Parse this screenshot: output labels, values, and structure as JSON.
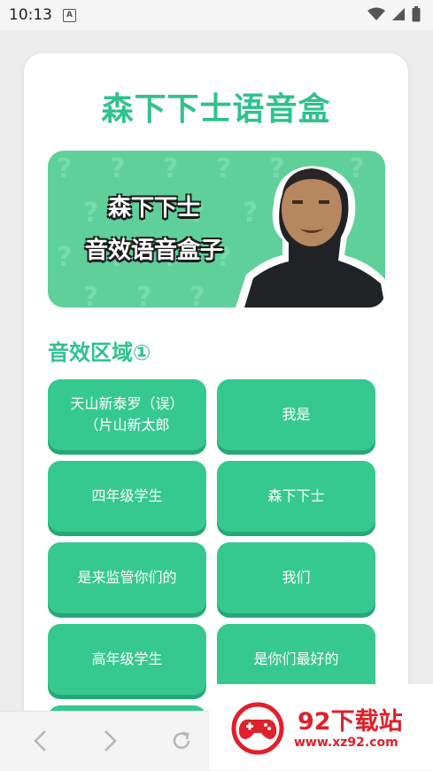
{
  "status_bar": {
    "time": "10:13",
    "notification_icon": "a-letter-icon",
    "wifi_icon": "wifi-icon",
    "signal_icon": "signal-icon",
    "battery_icon": "battery-icon"
  },
  "app": {
    "title": "森下下士语音盒",
    "banner": {
      "line1": "森下下士",
      "line2": "音效语音盒子"
    },
    "section_title": "音效区域①",
    "buttons": [
      "天山新泰罗（误）\n（片山新太郎",
      "我是",
      "四年级学生",
      "森下下士",
      "是来监管你们的",
      "我们",
      "高年级学生",
      "是你们最好的"
    ]
  },
  "bottom_nav": {
    "back_icon": "chevron-left-icon",
    "forward_icon": "chevron-right-icon",
    "reload_icon": "reload-icon"
  },
  "watermark": {
    "name": "92下载站",
    "url": "www.xz92.com"
  },
  "colors": {
    "accent": "#2fc28c",
    "button": "#36c891",
    "button_shadow": "#26a874",
    "watermark": "#e0202a"
  }
}
